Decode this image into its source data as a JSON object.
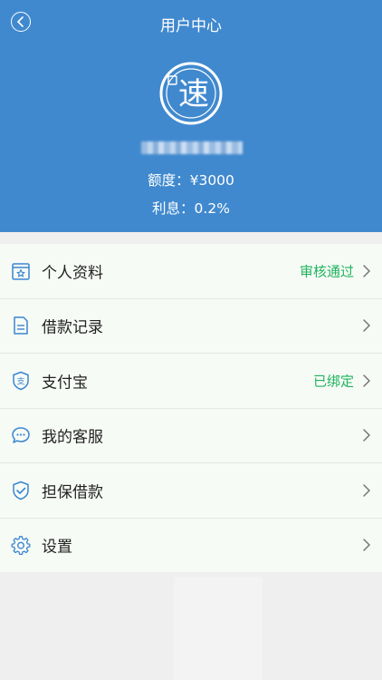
{
  "header": {
    "title": "用户中心",
    "logo_char": "速",
    "credit_text": "额度：¥3000",
    "interest_text": "利息：0.2%"
  },
  "menu": {
    "items": [
      {
        "label": "个人资料",
        "status": "审核通过",
        "icon": "id-card-star-icon"
      },
      {
        "label": "借款记录",
        "status": "",
        "icon": "document-icon"
      },
      {
        "label": "支付宝",
        "status": "已绑定",
        "icon": "alipay-shield-icon"
      },
      {
        "label": "我的客服",
        "status": "",
        "icon": "chat-bubbles-icon"
      },
      {
        "label": "担保借款",
        "status": "",
        "icon": "shield-check-icon"
      },
      {
        "label": "设置",
        "status": "",
        "icon": "gear-icon"
      }
    ]
  },
  "colors": {
    "header_bg": "#4089cf",
    "status_green": "#1fb35d",
    "icon_blue": "#3a86d1"
  }
}
